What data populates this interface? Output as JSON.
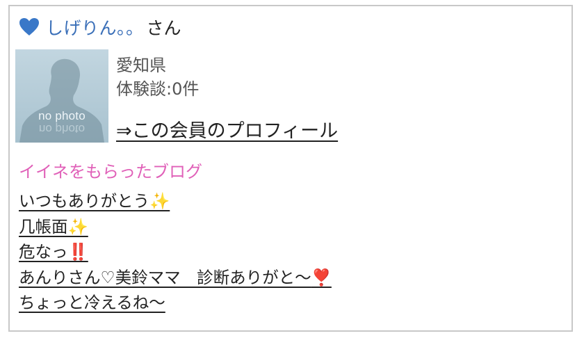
{
  "user": {
    "name": "しげりん。。",
    "suffix": "さん",
    "heart_color": "#3a78c8",
    "avatar": {
      "placeholder_text": "no photo"
    },
    "prefecture": "愛知県",
    "stories": "体験談:0件",
    "profile_link": "⇒この会員のプロフィール"
  },
  "liked_blogs": {
    "title": "イイネをもらったブログ",
    "title_color": "#e060b8",
    "items": [
      {
        "text": "いつもありがとう",
        "emoji": "✨"
      },
      {
        "text": "几帳面",
        "emoji": "✨"
      },
      {
        "text": "危なっ",
        "emoji": "‼️"
      },
      {
        "text": "あんりさん♡美鈴ママ　診断ありがと～",
        "emoji": "❣️"
      },
      {
        "text": "ちょっと冷えるね～",
        "emoji": ""
      }
    ]
  }
}
